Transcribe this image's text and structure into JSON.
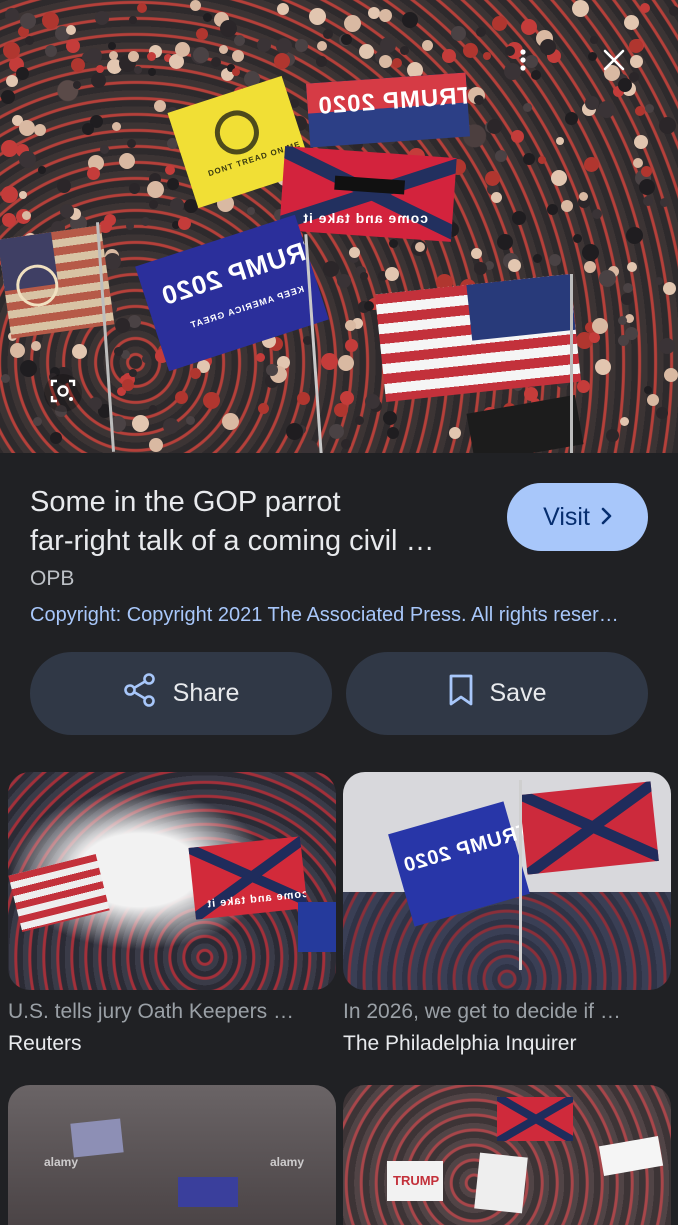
{
  "hero": {
    "lens_icon": "lens-icon",
    "more_icon": "more-vert-icon",
    "close_icon": "close-icon",
    "flag_texts": {
      "trump_2020_top": "TRUMP 2020",
      "dont_tread": "DONT TREAD ON ME",
      "come_and_take": "come and take it",
      "trump_blue": "TRUMP 2020",
      "keep_america": "KEEP AMERICA GREAT"
    }
  },
  "result": {
    "title_line1": "Some in the GOP parrot",
    "title_line2": "far-right talk of a coming civil …",
    "visit_label": "Visit",
    "visit_icon": "chevron-right-icon",
    "source": "OPB",
    "copyright": "Copyright: Copyright 2021 The Associated Press. All rights reser…"
  },
  "actions": {
    "share_label": "Share",
    "share_icon": "share-icon",
    "save_label": "Save",
    "save_icon": "bookmark-icon"
  },
  "related": [
    {
      "title": "U.S. tells jury Oath Keepers …",
      "source": "Reuters",
      "flag_text": "come and take it"
    },
    {
      "title": "In 2026, we get to decide if …",
      "source": "The Philadelphia Inquirer",
      "flag_text": "TRUMP 2020"
    },
    {
      "title": "",
      "source": "",
      "watermark": "alamy"
    },
    {
      "title": "",
      "source": "",
      "sign_text": "TRUMP"
    }
  ],
  "colors": {
    "background": "#202124",
    "accent": "#a8c7fa",
    "button_bg": "#303846"
  }
}
